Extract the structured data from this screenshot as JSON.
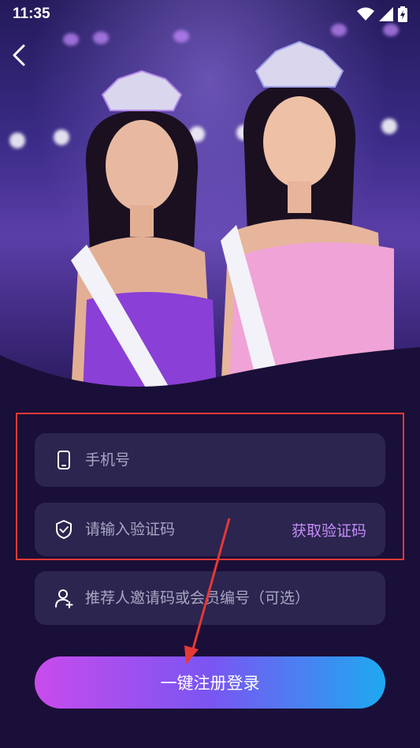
{
  "status_bar": {
    "time": "11:35"
  },
  "icons": {
    "back": "chevron-left-icon",
    "phone": "phone-icon",
    "shield": "shield-check-icon",
    "user_add": "user-add-icon"
  },
  "form": {
    "phone_placeholder": "手机号",
    "code_placeholder": "请输入验证码",
    "get_code_label": "获取验证码",
    "invite_placeholder": "推荐人邀请码或会员编号（可选）",
    "submit_label": "一键注册登录"
  },
  "colors": {
    "background": "#1a0f38",
    "field": "#2b2550",
    "accent_purple": "#c58cf5",
    "gradient_start": "#c94bec",
    "gradient_end": "#1ea9f0",
    "annotation_red": "#e53935"
  }
}
